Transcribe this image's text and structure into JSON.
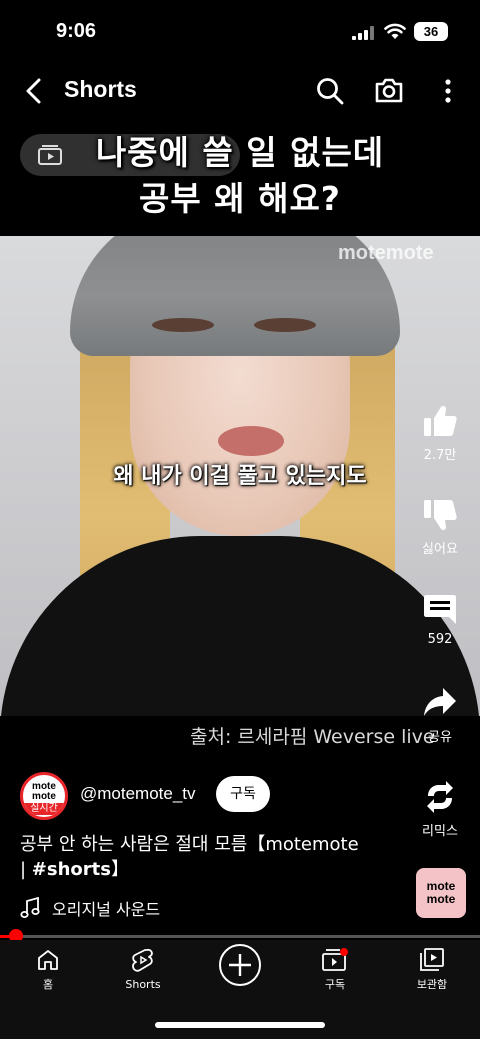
{
  "status": {
    "time": "9:06",
    "battery": "36"
  },
  "header": {
    "title": "Shorts",
    "icons": [
      "back-icon",
      "search-icon",
      "camera-icon",
      "more-icon"
    ]
  },
  "video": {
    "headline_line1": "나중에 쓸 일 없는데",
    "headline_line2": "공부 왜 해요?",
    "watermark": "motemote",
    "subtitle": "왜 내가 이걸 풀고 있는지도",
    "credit": "출처: 르세라핌 Weverse live"
  },
  "actions": {
    "like_count": "2.7만",
    "dislike_label": "싫어요",
    "comment_count": "592",
    "share_label": "공유",
    "remix_label": "리믹스"
  },
  "channel": {
    "avatar_line1": "mote",
    "avatar_line2": "mote",
    "avatar_badge": "실시간",
    "handle": "@motemote_tv",
    "subscribe_label": "구독"
  },
  "description": {
    "text": "공부 안 하는 사람은 절대 모름【motemote | ",
    "hashtag": "#shorts",
    "suffix": "】"
  },
  "sound": {
    "label": "오리지널 사운드",
    "thumb_line1": "mote",
    "thumb_line2": "mote"
  },
  "playback": {
    "progress_fraction": 0.03
  },
  "nav": {
    "home": "홈",
    "shorts": "Shorts",
    "subscriptions": "구독",
    "library": "보관함"
  },
  "colors": {
    "accent": "#ff0000",
    "avatar_ring": "#e8262a",
    "sound_thumb_bg": "#f4c3c7"
  }
}
